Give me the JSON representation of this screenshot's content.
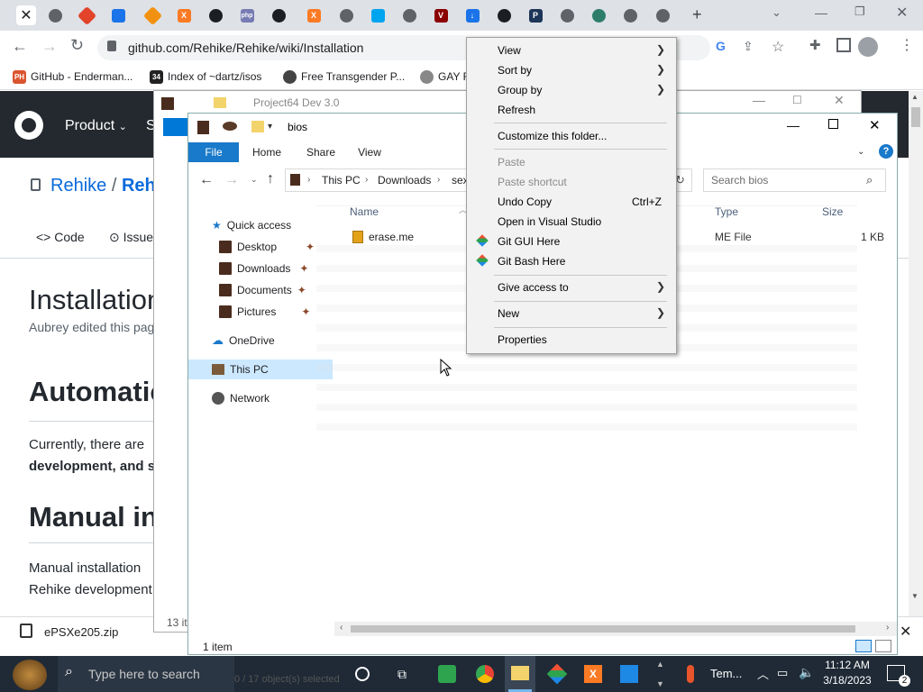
{
  "browser": {
    "url": "github.com/Rehike/Rehike/wiki/Installation",
    "bookmarks": [
      "GitHub - Enderman...",
      "Index of ~dartz/isos",
      "Free Transgender P...",
      "GAY R"
    ]
  },
  "github": {
    "nav_product": "Product",
    "nav_s": "S",
    "repo_owner": "Rehike",
    "repo_sep": "/",
    "repo_name": "Rehike",
    "tab_code": "Code",
    "tab_issues": "Issue",
    "page_title": "Installation",
    "edited": "Aubrey edited this pag",
    "h_auto": "Automatic i",
    "p1a": "Currently, there are",
    "p1b": "development, and sh",
    "h_manual": "Manual ins",
    "p2a": "Manual installation",
    "p2b": "Rehike development"
  },
  "download": {
    "file": "ePSXe205.zip"
  },
  "explorer_back": {
    "title": "Project64 Dev 3.0",
    "status": "13 ite",
    "status2": "0 / 17 object(s) selected"
  },
  "explorer": {
    "title": "bios",
    "tabs": [
      "File",
      "Home",
      "Share",
      "View"
    ],
    "breadcrumb": [
      "This PC",
      "Downloads",
      "sex"
    ],
    "search_placeholder": "Search bios",
    "nav": {
      "quick_access": "Quick access",
      "desktop": "Desktop",
      "downloads": "Downloads",
      "documents": "Documents",
      "pictures": "Pictures",
      "onedrive": "OneDrive",
      "this_pc": "This PC",
      "network": "Network"
    },
    "columns": {
      "name": "Name",
      "type": "Type",
      "size": "Size"
    },
    "file": {
      "name": "erase.me",
      "type": "ME File",
      "size": "1 KB"
    },
    "status": "1 item"
  },
  "context_menu": {
    "view": "View",
    "sort_by": "Sort by",
    "group_by": "Group by",
    "refresh": "Refresh",
    "customize": "Customize this folder...",
    "paste": "Paste",
    "paste_shortcut": "Paste shortcut",
    "undo_copy": "Undo Copy",
    "undo_shortcut": "Ctrl+Z",
    "open_vs": "Open in Visual Studio",
    "git_gui": "Git GUI Here",
    "git_bash": "Git Bash Here",
    "give_access": "Give access to",
    "new": "New",
    "properties": "Properties"
  },
  "taskbar": {
    "search_placeholder": "Type here to search",
    "weather": "Tem...",
    "time": "11:12 AM",
    "date": "3/18/2023",
    "notif_count": "2"
  },
  "colors": {
    "accent": "#0078d7",
    "github_dark": "#24292f",
    "taskbar": "#1f2a36"
  }
}
